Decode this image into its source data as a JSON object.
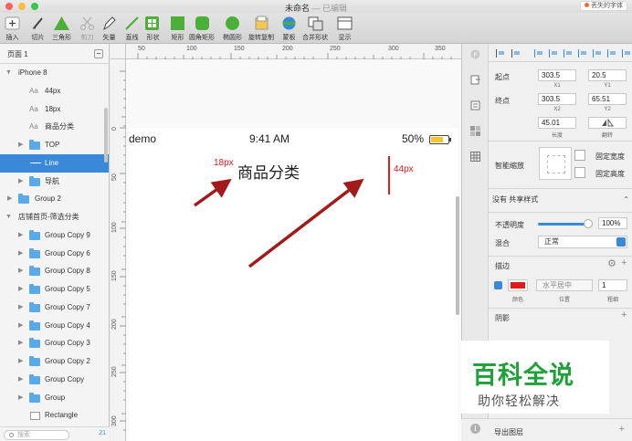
{
  "window": {
    "title": "未命名",
    "edited": "— 已编辑",
    "missing_fonts": "丢失的字体"
  },
  "toolbar": {
    "items": [
      {
        "label": "插入",
        "icon": "plus-icon"
      },
      {
        "label": "切片",
        "icon": "slice-icon"
      },
      {
        "label": "三角形",
        "icon": "triangle-icon"
      },
      {
        "label": "剪刀",
        "icon": "scissors-icon"
      },
      {
        "label": "矢量",
        "icon": "pen-icon"
      },
      {
        "label": "直线",
        "icon": "line-icon"
      },
      {
        "label": "形状",
        "icon": "shapes-icon"
      },
      {
        "label": "矩形",
        "icon": "rectangle-icon"
      },
      {
        "label": "圆角矩形",
        "icon": "rounded-rect-icon"
      },
      {
        "label": "椭圆形",
        "icon": "oval-icon"
      },
      {
        "label": "旋转复制",
        "icon": "rotate-copy-icon"
      },
      {
        "label": "蒙板",
        "icon": "mask-icon"
      },
      {
        "label": "合并形状",
        "icon": "combine-icon"
      },
      {
        "label": "显示",
        "icon": "display-icon"
      }
    ]
  },
  "sidebar": {
    "page": "页面 1",
    "layers": [
      {
        "label": "iPhone 8",
        "kind": "artboard"
      },
      {
        "label": "44px",
        "kind": "text"
      },
      {
        "label": "18px",
        "kind": "text"
      },
      {
        "label": "商品分类",
        "kind": "text"
      },
      {
        "label": "TOP",
        "kind": "group"
      },
      {
        "label": "Line",
        "kind": "line"
      },
      {
        "label": "导航",
        "kind": "group"
      },
      {
        "label": "Group 2",
        "kind": "group"
      },
      {
        "label": "店铺首页-筛选分类",
        "kind": "artboard"
      },
      {
        "label": "Group Copy 9",
        "kind": "group"
      },
      {
        "label": "Group Copy 6",
        "kind": "group"
      },
      {
        "label": "Group Copy 8",
        "kind": "group"
      },
      {
        "label": "Group Copy 5",
        "kind": "group"
      },
      {
        "label": "Group Copy 7",
        "kind": "group"
      },
      {
        "label": "Group Copy 4",
        "kind": "group"
      },
      {
        "label": "Group Copy 3",
        "kind": "group"
      },
      {
        "label": "Group Copy 2",
        "kind": "group"
      },
      {
        "label": "Group Copy",
        "kind": "group"
      },
      {
        "label": "Group",
        "kind": "group"
      },
      {
        "label": "Rectangle",
        "kind": "rect"
      }
    ],
    "search_placeholder": "搜索",
    "layer_count": "21"
  },
  "rulers": {
    "top": [
      "50",
      "100",
      "150",
      "200",
      "250",
      "300",
      "350"
    ],
    "left": [
      "0",
      "50",
      "100",
      "150",
      "200",
      "250",
      "300"
    ]
  },
  "canvas": {
    "carrier": "demo",
    "time": "9:41 AM",
    "battery": "50%",
    "title": "商品分类",
    "ann_18": "18px",
    "ann_44": "44px"
  },
  "inspector": {
    "start": "起点",
    "end": "终点",
    "x1": "303.5",
    "y1": "20.5",
    "x2": "303.5",
    "y2": "65.51",
    "x1_label": "X1",
    "y1_label": "Y1",
    "x2_label": "X2",
    "y2_label": "Y2",
    "length": "45.01",
    "length_label": "长度",
    "flip_label": "翻转",
    "smart_resize": "智能缩放",
    "fix_width": "固定宽度",
    "fix_height": "固定高度",
    "shared_style": "没有 共享样式",
    "opacity_label": "不透明度",
    "opacity": "100%",
    "blend_label": "混合",
    "blend": "正常",
    "stroke_title": "描边",
    "stroke_color_label": "颜色",
    "stroke_pos": "水平居中",
    "stroke_pos_label": "位置",
    "stroke_width": "1",
    "stroke_width_label": "粗细",
    "shadow_title": "阴影",
    "export_title": "导出图层",
    "stroke_color": "#e0191f"
  },
  "watermark": {
    "main": "百科全说",
    "sub": "助你轻松解决"
  }
}
